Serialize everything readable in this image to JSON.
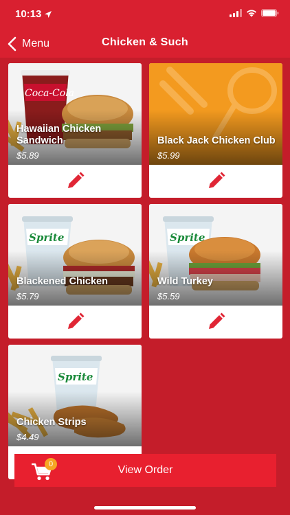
{
  "status_bar": {
    "time": "10:13"
  },
  "nav": {
    "back_label": "Menu",
    "title": "Chicken & Such"
  },
  "items": [
    {
      "name": "Hawaiian Chicken Sandwich",
      "price": "$5.89"
    },
    {
      "name": "Black Jack Chicken Club",
      "price": "$5.99"
    },
    {
      "name": "Blackened Chicken",
      "price": "$5.79"
    },
    {
      "name": "Wild Turkey",
      "price": "$5.59"
    },
    {
      "name": "Chicken Strips",
      "price": "$4.49"
    }
  ],
  "cart": {
    "count": "0",
    "button_label": "View Order"
  },
  "colors": {
    "brand_red": "#d92030",
    "background_red": "#c41d2a",
    "badge_orange": "#f6a623",
    "placeholder_orange": "#f39a1f"
  }
}
